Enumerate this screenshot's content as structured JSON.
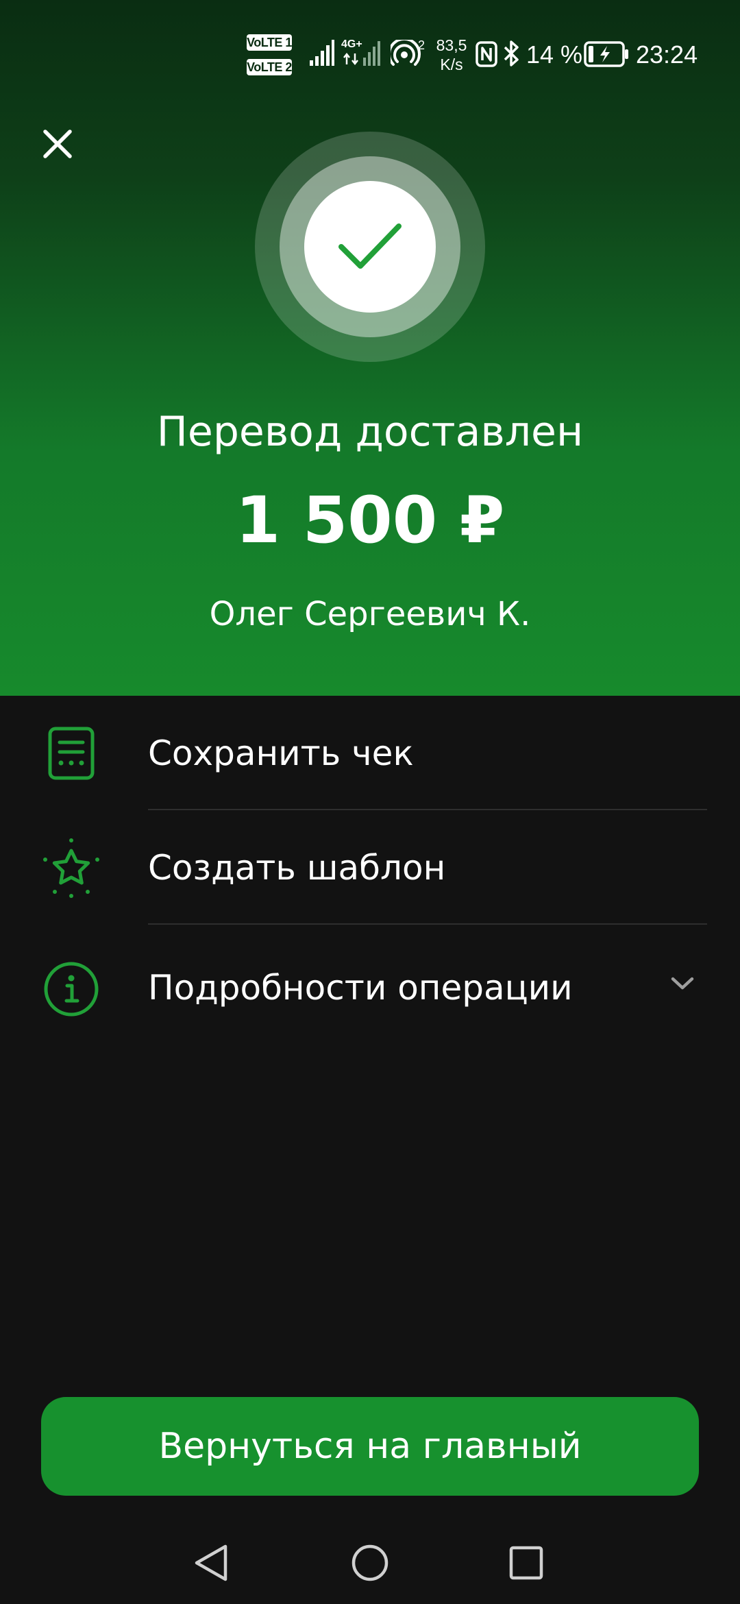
{
  "status_bar": {
    "volte_1": "VoLTE 1",
    "volte_2": "VoLTE 2",
    "network_type": "4G+",
    "hotspot_count": "2",
    "net_speed_value": "83,5",
    "net_speed_unit": "K/s",
    "battery_percent": "14 %",
    "time": "23:24"
  },
  "hero": {
    "title": "Перевод доставлен",
    "amount": "1 500 ₽",
    "recipient": "Олег Сергеевич К."
  },
  "actions": [
    {
      "label": "Сохранить чек",
      "icon": "receipt-icon"
    },
    {
      "label": "Создать шаблон",
      "icon": "star-icon"
    },
    {
      "label": "Подробности операции",
      "icon": "info-icon"
    }
  ],
  "home_button": {
    "label": "Вернуться на главный"
  },
  "colors": {
    "accent": "#21a038",
    "button": "#17912e",
    "background": "#121212",
    "hero_top": "#0a2d12",
    "hero_bottom": "#178a2c"
  }
}
